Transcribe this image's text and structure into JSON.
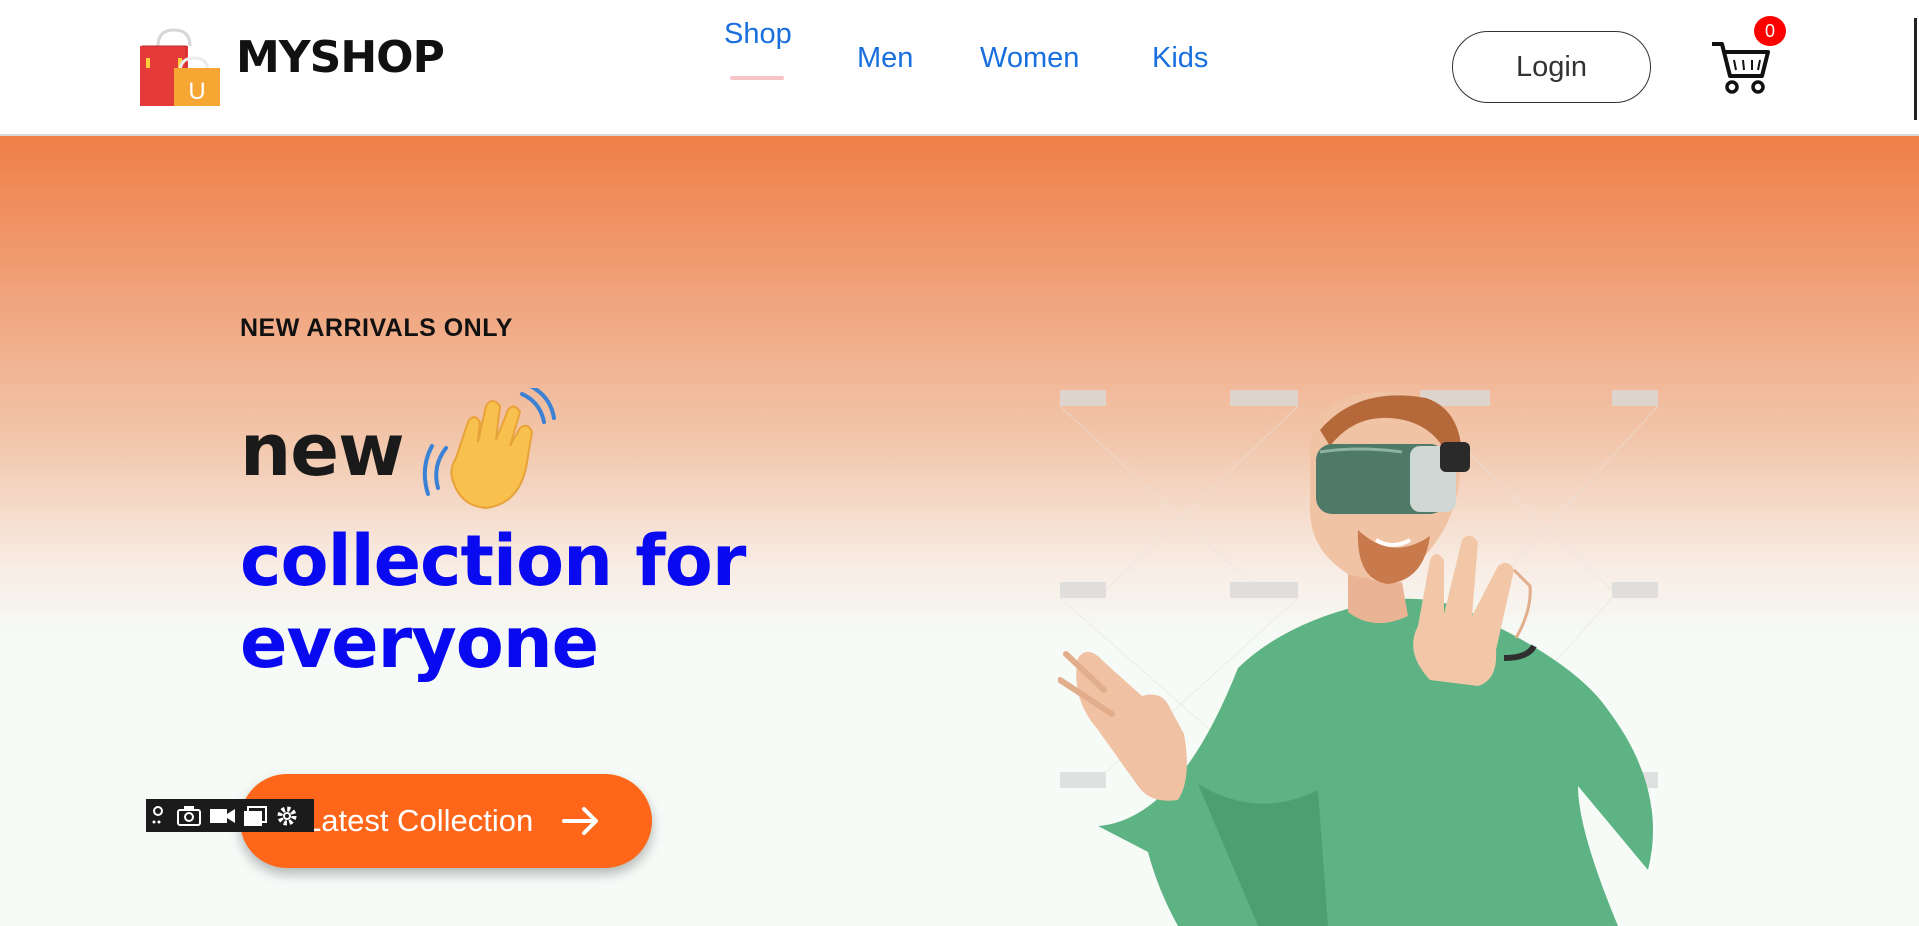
{
  "brand": {
    "name": "MYSHOP",
    "logo_letter": "U"
  },
  "nav": {
    "links": [
      {
        "label": "Shop"
      },
      {
        "label": "Men"
      },
      {
        "label": "Women"
      },
      {
        "label": "Kids"
      }
    ]
  },
  "header": {
    "login_label": "Login",
    "cart_count": "0"
  },
  "hero": {
    "eyebrow": "NEW ARRIVALS ONLY",
    "title_line1": "new",
    "title_line2": "collection for everyone",
    "cta_label": "Latest Collection"
  },
  "colors": {
    "accent": "#ff661a",
    "nav_link": "#1a6fde",
    "title_blue": "#0a0af0",
    "badge": "#ff0000"
  },
  "icons": {
    "logo": "shopping-bags-icon",
    "cart": "cart-icon",
    "wave": "waving-hand-icon",
    "cta_arrow": "arrow-right-icon"
  }
}
